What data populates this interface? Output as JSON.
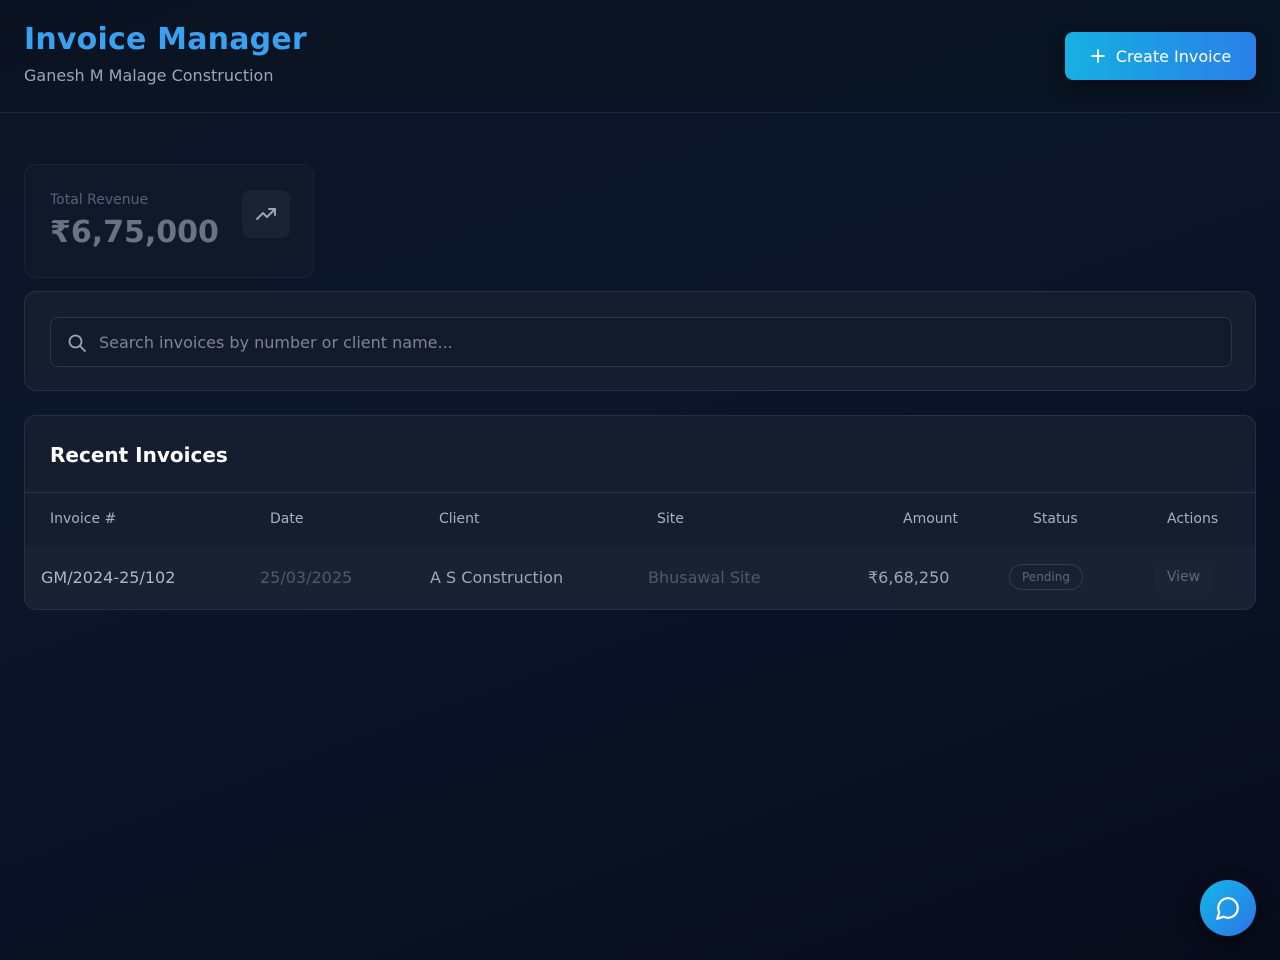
{
  "header": {
    "title": "Invoice Manager",
    "subtitle": "Ganesh M Malage Construction",
    "create_button_label": "Create Invoice"
  },
  "stats": {
    "total_revenue_label": "Total Revenue",
    "total_revenue_value": "₹6,75,000",
    "icon": "trending-up-icon"
  },
  "search": {
    "placeholder": "Search invoices by number or client name...",
    "value": ""
  },
  "invoices": {
    "title": "Recent Invoices",
    "columns": [
      "Invoice #",
      "Date",
      "Client",
      "Site",
      "Amount",
      "Status",
      "Actions"
    ],
    "rows": [
      {
        "invoice_no": "GM/2024-25/102",
        "date": "25/03/2025",
        "client": "A S Construction",
        "site": "Bhusawal Site",
        "amount": "₹6,68,250",
        "status": "Pending",
        "action": "View"
      }
    ]
  },
  "colors": {
    "accent": "#3aa0f0",
    "button_gradient_start": "#16b0e2",
    "button_gradient_end": "#2a7fe8",
    "background": "#0c1729"
  },
  "chat": {
    "icon": "chat-bubble-icon"
  }
}
